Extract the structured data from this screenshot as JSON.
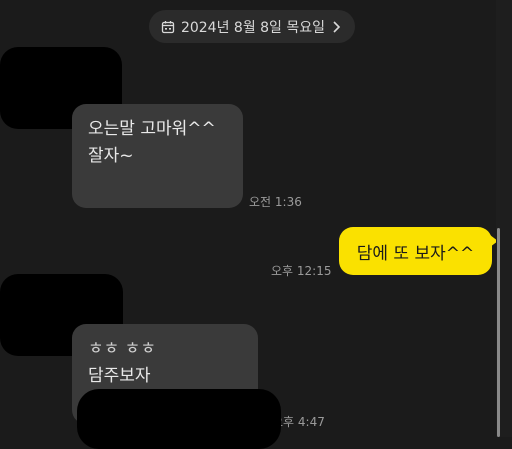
{
  "date_bar": {
    "label": "2024년 8월 8일 목요일",
    "icon": "calendar-icon",
    "chevron": "chevron-right-icon"
  },
  "messages": [
    {
      "side": "in",
      "lines": [
        "오는말 고마워^^",
        "잘자~"
      ],
      "time": "오전 1:36"
    },
    {
      "side": "out",
      "text": "담에 또 보자^^",
      "time": "오후 12:15"
    },
    {
      "side": "in",
      "lines": [
        "ㅎㅎ ㅎㅎ",
        "담주보자"
      ],
      "time": "오후 4:47"
    }
  ],
  "colors": {
    "background": "#1b1b1b",
    "bubble_in": "#3a3a3a",
    "bubble_out": "#fae100",
    "time": "#9a9a9a"
  }
}
